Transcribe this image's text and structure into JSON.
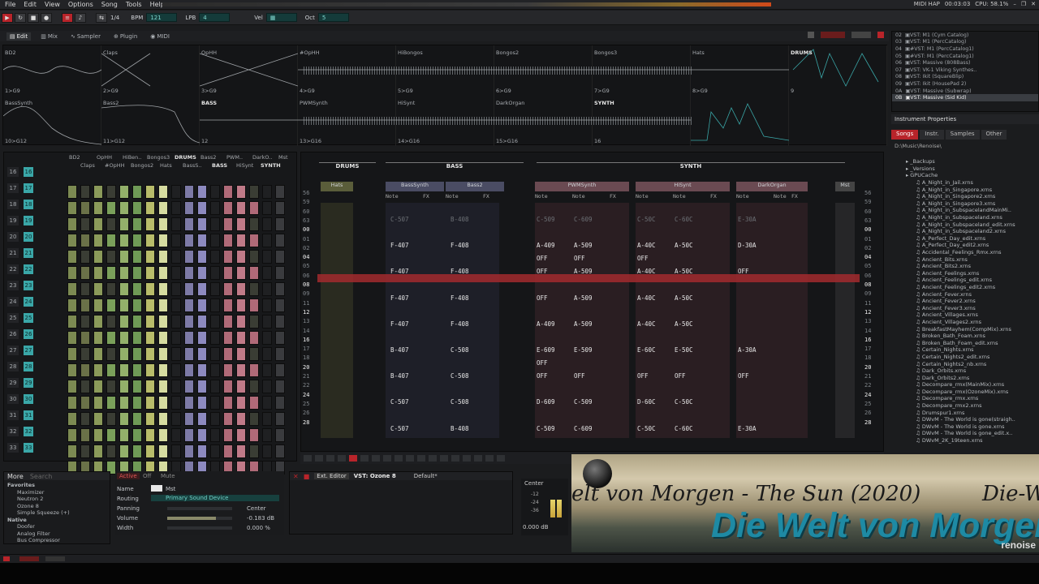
{
  "menu": [
    "File",
    "Edit",
    "View",
    "Options",
    "Song",
    "Tools",
    "Help"
  ],
  "status_right": {
    "midi": "MIDI HAP",
    "time": "00:03:03",
    "cpu": "CPU: 58.1%"
  },
  "transport": {
    "pattern_num": "1/4",
    "bpm_label": "BPM",
    "bpm": "121",
    "lpb_label": "LPB",
    "lpb": "4",
    "vel_label": "Vel",
    "oct_label": "Oct",
    "oct": "5"
  },
  "tabs": [
    "Edit",
    "Mix",
    "Sampler",
    "Plugin",
    "MIDI"
  ],
  "scopes": {
    "row1": [
      {
        "name": "BD2",
        "idx": "1>G9"
      },
      {
        "name": "Claps",
        "idx": "2>G9"
      },
      {
        "name": "OpHH",
        "idx": "3>G9"
      },
      {
        "name": "#OpHH",
        "idx": "4>G9"
      },
      {
        "name": "HiBongos",
        "idx": "5>G9"
      },
      {
        "name": "Bongos2",
        "idx": "6>G9"
      },
      {
        "name": "Bongos3",
        "idx": "7>G9"
      },
      {
        "name": "Hats",
        "idx": "8>G9"
      },
      {
        "name": "DRUMS",
        "idx": "9"
      }
    ],
    "row2": [
      {
        "name": "BassSynth",
        "idx": "10>G12"
      },
      {
        "name": "Bass2",
        "idx": "11>G12"
      },
      {
        "name": "BASS",
        "idx": "12"
      },
      {
        "name": "PWMSynth",
        "idx": "13>G16"
      },
      {
        "name": "HiSynt",
        "idx": "14>G16"
      },
      {
        "name": "DarkOrgan",
        "idx": "15>G16"
      },
      {
        "name": "SYNTH",
        "idx": "16"
      },
      {
        "name": "",
        "idx": ""
      },
      {
        "name": "",
        "idx": ""
      }
    ]
  },
  "matrix": {
    "rows": [
      "16",
      "17",
      "18",
      "19",
      "20",
      "21",
      "22",
      "23",
      "24",
      "25",
      "26",
      "27",
      "28",
      "29",
      "30",
      "31",
      "32",
      "33"
    ],
    "head1": [
      "BD2",
      "OpHH",
      "HiBen..",
      "Bongos3",
      "DRUMS",
      "Bass2",
      "PWM..",
      "DarkO..",
      "Mst"
    ],
    "head2": [
      "Claps",
      "#OpHH",
      "Bongos2",
      "Hats",
      "BassS..",
      "BASS",
      "HiSynt",
      "SYNTH"
    ]
  },
  "pattern": {
    "groups": [
      "DRUMS",
      "BASS",
      "SYNTH"
    ],
    "tracks": [
      "Hats",
      "BassSynth",
      "Bass2",
      "PWMSynth",
      "HiSynt",
      "DarkOrgan",
      "Mst"
    ],
    "lines": [
      "56",
      "59",
      "60",
      "63",
      "00",
      "01",
      "02",
      "04",
      "05",
      "06",
      "08",
      "09",
      "11",
      "12",
      "13",
      "14",
      "16",
      "17",
      "18",
      "20",
      "21",
      "22",
      "24",
      "25",
      "26",
      "28"
    ],
    "hi_lines": [
      "00",
      "04",
      "08",
      "12",
      "16",
      "20",
      "24",
      "28"
    ],
    "col_bass1": [
      "C-507",
      "",
      "F-407",
      "",
      "F-407",
      "",
      "F-407",
      "",
      "F-407",
      "",
      "B-407",
      "",
      "B-407",
      "",
      "C-507",
      "",
      "C-507"
    ],
    "col_bass2": [
      "B-408",
      "",
      "F-408",
      "",
      "F-408",
      "",
      "F-408",
      "",
      "F-408",
      "",
      "C-508",
      "",
      "C-508",
      "",
      "C-508",
      "",
      "B-408"
    ],
    "col_s1": [
      "C-509",
      "",
      "A-409",
      "OFF",
      "OFF",
      "",
      "OFF",
      "",
      "A-409",
      "",
      "E-609",
      "OFF",
      "OFF",
      "",
      "D-609",
      "",
      "C-509"
    ],
    "col_s2": [
      "C-609",
      "",
      "A-509",
      "OFF",
      "A-509",
      "",
      "A-509",
      "",
      "A-509",
      "",
      "E-509",
      "",
      "OFF",
      "",
      "C-509",
      "",
      "C-609"
    ],
    "col_s3": [
      "C-50C",
      "",
      "A-40C",
      "OFF",
      "A-40C",
      "",
      "A-40C",
      "",
      "A-40C",
      "",
      "E-60C",
      "",
      "OFF",
      "",
      "D-60C",
      "",
      "C-50C"
    ],
    "col_s4": [
      "C-60C",
      "",
      "A-50C",
      "",
      "A-50C",
      "",
      "A-50C",
      "",
      "A-50C",
      "",
      "E-50C",
      "",
      "OFF",
      "",
      "C-50C",
      "",
      "C-60C"
    ],
    "col_s5": [
      "E-30A",
      "",
      "D-30A",
      "",
      "OFF",
      "",
      "",
      "",
      "",
      "",
      "A-30A",
      "",
      "OFF",
      "",
      "",
      "",
      "E-30A"
    ],
    "sub_labels": {
      "note": "Note",
      "fx": "FX",
      "play": "PLAY"
    }
  },
  "instruments": [
    "VST: M1 (Cym Catalog)",
    "VST: M1 (PercCatalog)",
    "#VST: M1 (PercCatalog1)",
    "#VST: M1 (PercCatalog1)",
    "VST: Massive (808Bass)",
    "VST: VK-1 Viking Synthes..",
    "VST: Ikit (SquareBlip)",
    "VST: Ikit (HousePad 2)",
    "VST: Massive (Subwrap)",
    "VST: Massive (Sid Kid)"
  ],
  "instrument_nums": [
    "02",
    "03",
    "04",
    "05",
    "06",
    "07",
    "08",
    "09",
    "0A",
    "0B",
    "0C"
  ],
  "instrument_properties": "Instrument Properties",
  "right_tabs": [
    "Songs",
    "Instr.",
    "Samples",
    "Other"
  ],
  "browser_path": "D:\\Music\\Renoise\\",
  "files": [
    "_Backups",
    "_Versions",
    "GPUCache",
    "A_Night_in_Jail.xrns",
    "A_Night_in_Singapore.xrns",
    "A_Night_in_Singapore2.xrns",
    "A_Night_in_Singapore3.xrns",
    "A_Night_in_SubspacelandMainMi..",
    "A_Night_in_Subspaceland.xrns",
    "A_Night_in_Subspaceland_edit.xrns",
    "A_Night_in_Subspaceland2.xrns",
    "A_Perfect_Day_edit.xrns",
    "A_Perfect_Day_edit2.xrns",
    "Accidental_Feelings_Rmx.xrns",
    "Ancient_Bits.xrns",
    "Ancient_Bits2.xrns",
    "Ancient_Feelings.xrns",
    "Ancient_Feelings_edit.xrns",
    "Ancient_Feelings_edit2.xrns",
    "Ancient_Fever.xrns",
    "Ancient_Fever2.xrns",
    "Ancient_Fever3.xrns",
    "Ancient_Villages.xrns",
    "Ancient_Villages2.xrns",
    "BreakfastMayhem(CompMix).xrns",
    "Broken_Bath_Foam.xrns",
    "Broken_Bath_Foam_edit.xrns",
    "Certain_Nights.xrns",
    "Certain_Nights2_edit.xrns",
    "Certain_Nights2_nb.xrns",
    "Dark_Orbits.xrns",
    "Dark_Orbits2.xrns",
    "Decompare_rmx(MainMix).xrns",
    "Decompare_rmx(OzoneMix).xrns",
    "Decompare_rmx.xrns",
    "Decompare_rmx2.xrns",
    "Drumspur1.xrns",
    "DWvM - The World is gone(straigh..",
    "DWvM - The World is gone.xrns",
    "DWvM - The World is gone_edit.x..",
    "DWvM_2K_19teen.xrns"
  ],
  "dsp": {
    "more": "More",
    "search": "Search",
    "favorites": "Favorites",
    "fav_items": [
      "Maximizer",
      "Neutron 2",
      "Ozone 8",
      "Simple Squeeze (+)"
    ],
    "native": "Native",
    "native_items": [
      "Doofer",
      "Analog Filter",
      "Bus Compressor"
    ]
  },
  "trackprops": {
    "active": "Active",
    "off": "Off",
    "mute": "Mute",
    "name_label": "Name",
    "name": "Mst",
    "routing_label": "Routing",
    "routing": "Primary Sound Device",
    "panning_label": "Panning",
    "panning": "Center",
    "volume_label": "Volume",
    "volume": "-0.183 dB",
    "width_label": "Width",
    "width": "0.000 %"
  },
  "device": {
    "ext": "Ext. Editor",
    "name": "VST: Ozone 8",
    "preset": "Default*"
  },
  "meter": {
    "pan": "Center",
    "db": "0.000 dB",
    "ticks": [
      "-12",
      "-24",
      "-36"
    ]
  },
  "video": {
    "line1": "elt von Morgen - The Sun (2020)",
    "line1b": "Die-We",
    "line2": "Die Welt von Morgen",
    "brand": "renoise"
  },
  "colors": {
    "accent": "#b8242a",
    "teal": "#3aa7a8",
    "drums": "#d6dca0",
    "bass": "#b8bde6",
    "synth": "#e6a9b4"
  }
}
